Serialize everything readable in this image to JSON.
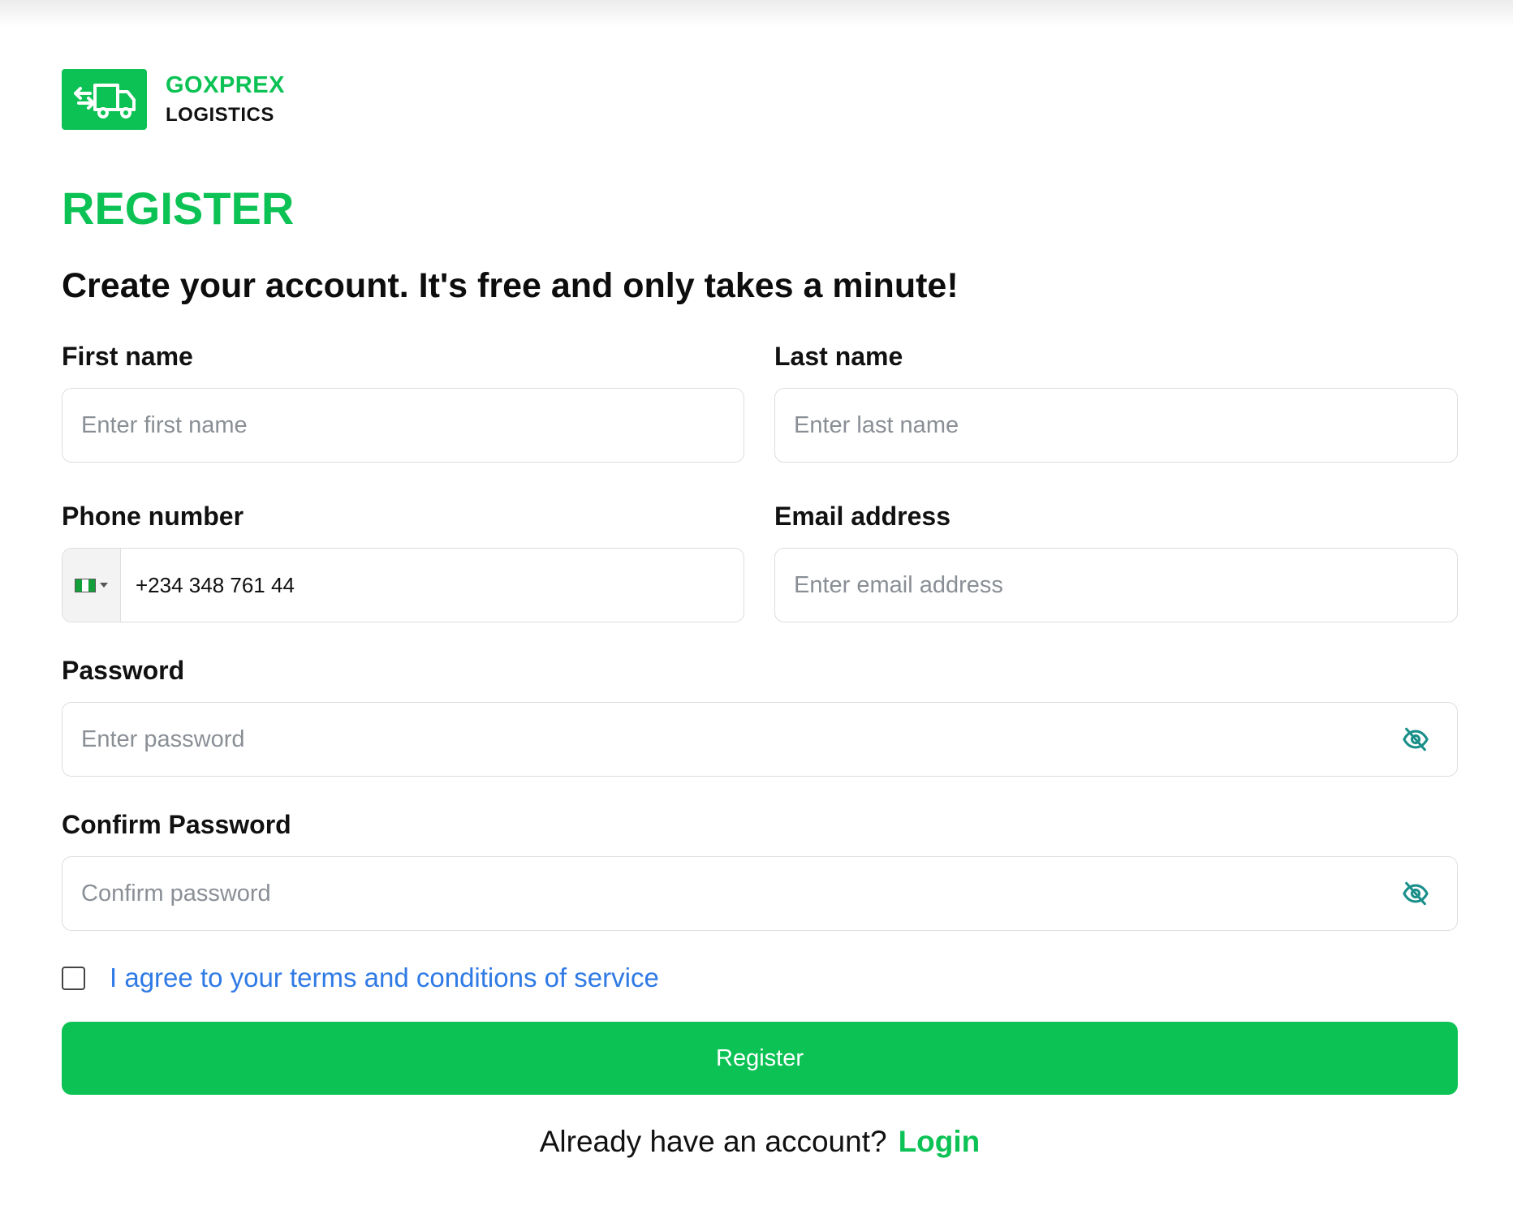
{
  "brand": {
    "name": "GOXPREX",
    "sub": "LOGISTICS",
    "color": "#0cc254"
  },
  "heading": {
    "title": "REGISTER",
    "subtitle": "Create your account. It's free and only takes a minute!"
  },
  "form": {
    "first_name": {
      "label": "First name",
      "placeholder": "Enter first name"
    },
    "last_name": {
      "label": "Last name",
      "placeholder": "Enter last name"
    },
    "phone": {
      "label": "Phone number",
      "value": "+234 348 761 44",
      "country_flag": "nigeria-flag-icon"
    },
    "email": {
      "label": "Email address",
      "placeholder": "Enter email address"
    },
    "password": {
      "label": "Password",
      "placeholder": "Enter password",
      "toggle_icon": "eye-slash-icon"
    },
    "confirm_password": {
      "label": "Confirm Password",
      "placeholder": "Confirm password",
      "toggle_icon": "eye-slash-icon"
    },
    "agree_text": "I agree to your terms and conditions of service",
    "submit_label": "Register"
  },
  "footer": {
    "prompt": "Already have an account?",
    "login_label": "Login"
  },
  "colors": {
    "accent": "#0cc254",
    "link": "#2f7ae5",
    "eye_icon": "#1a8f8a"
  }
}
